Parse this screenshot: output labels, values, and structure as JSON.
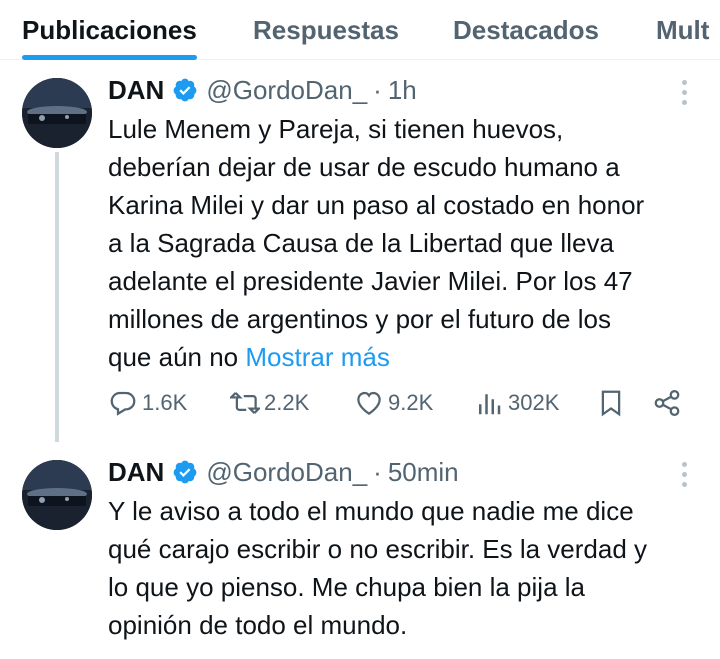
{
  "tabs": [
    {
      "label": "Publicaciones",
      "active": true
    },
    {
      "label": "Respuestas",
      "active": false
    },
    {
      "label": "Destacados",
      "active": false
    },
    {
      "label": "Mult",
      "active": false
    }
  ],
  "tweets": [
    {
      "name": "DAN",
      "handle": "@GordoDan_",
      "separator": "·",
      "time": "1h",
      "lines": [
        "Lule Menem y Pareja, si tienen huevos,",
        "deberían dejar de usar de escudo humano a",
        "Karina Milei y dar un paso al costado en honor",
        "a la Sagrada Causa de la Libertad que lleva",
        "adelante el presidente Javier Milei. Por los 47",
        "millones de argentinos y por el futuro de los"
      ],
      "last_line": "que aún no",
      "show_more": "Mostrar más",
      "stats": {
        "replies": "1.6K",
        "reposts": "2.2K",
        "likes": "9.2K",
        "views": "302K"
      }
    },
    {
      "name": "DAN",
      "handle": "@GordoDan_",
      "separator": "·",
      "time": "50min",
      "lines": [
        "Y le aviso a todo el mundo que nadie me dice",
        "qué carajo escribir o no escribir. Es la verdad y",
        "lo que yo pienso. Me chupa bien la pija la",
        "opinión de todo el mundo."
      ]
    }
  ],
  "colors": {
    "accent": "#1d9bf0",
    "text": "#0f1419",
    "secondary": "#536471",
    "thread_line": "#cfd9de"
  }
}
